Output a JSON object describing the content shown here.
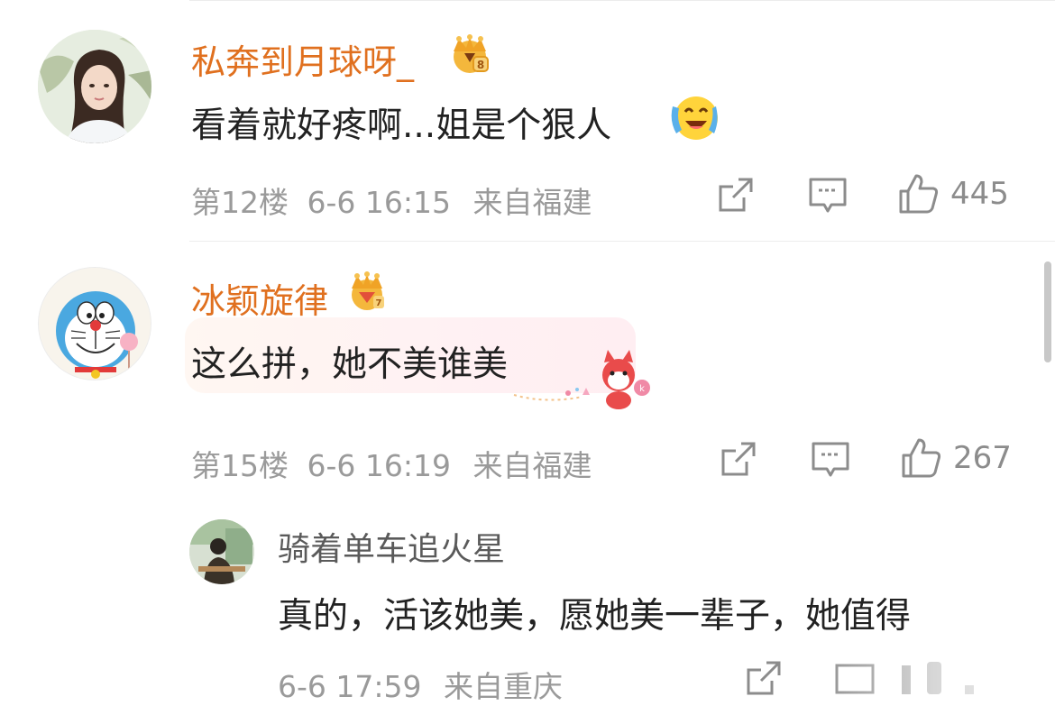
{
  "comments": [
    {
      "username": "私奔到月球呀_",
      "text": "看着就好疼啊...姐是个狠人",
      "floor": "第12楼",
      "time": "6-6 16:15",
      "source": "来自福建",
      "likes": "445",
      "avatar_icon": "woman-portrait",
      "badge_icon": "gold-crown-badge",
      "emoji_icon": "crying-laughing-emoji"
    },
    {
      "username": "冰颖旋律",
      "text": "这么拼，她不美谁美",
      "floor": "第15楼",
      "time": "6-6 16:19",
      "source": "来自福建",
      "likes": "267",
      "avatar_icon": "doraemon",
      "badge_icon": "gold-crown-badge",
      "bubble_decoration": "cartoon-fox"
    }
  ],
  "reply": {
    "username": "骑着单车追火星",
    "text": "真的，活该她美，愿她美一辈子，她值得",
    "time": "6-6 17:59",
    "source": "来自重庆",
    "avatar_icon": "person-photo"
  },
  "icons": {
    "share": "share-icon",
    "comment": "comment-icon",
    "like": "thumbs-up-icon"
  },
  "colors": {
    "username": "#e0701f",
    "meta": "#9a9a9a",
    "text": "#222222"
  }
}
